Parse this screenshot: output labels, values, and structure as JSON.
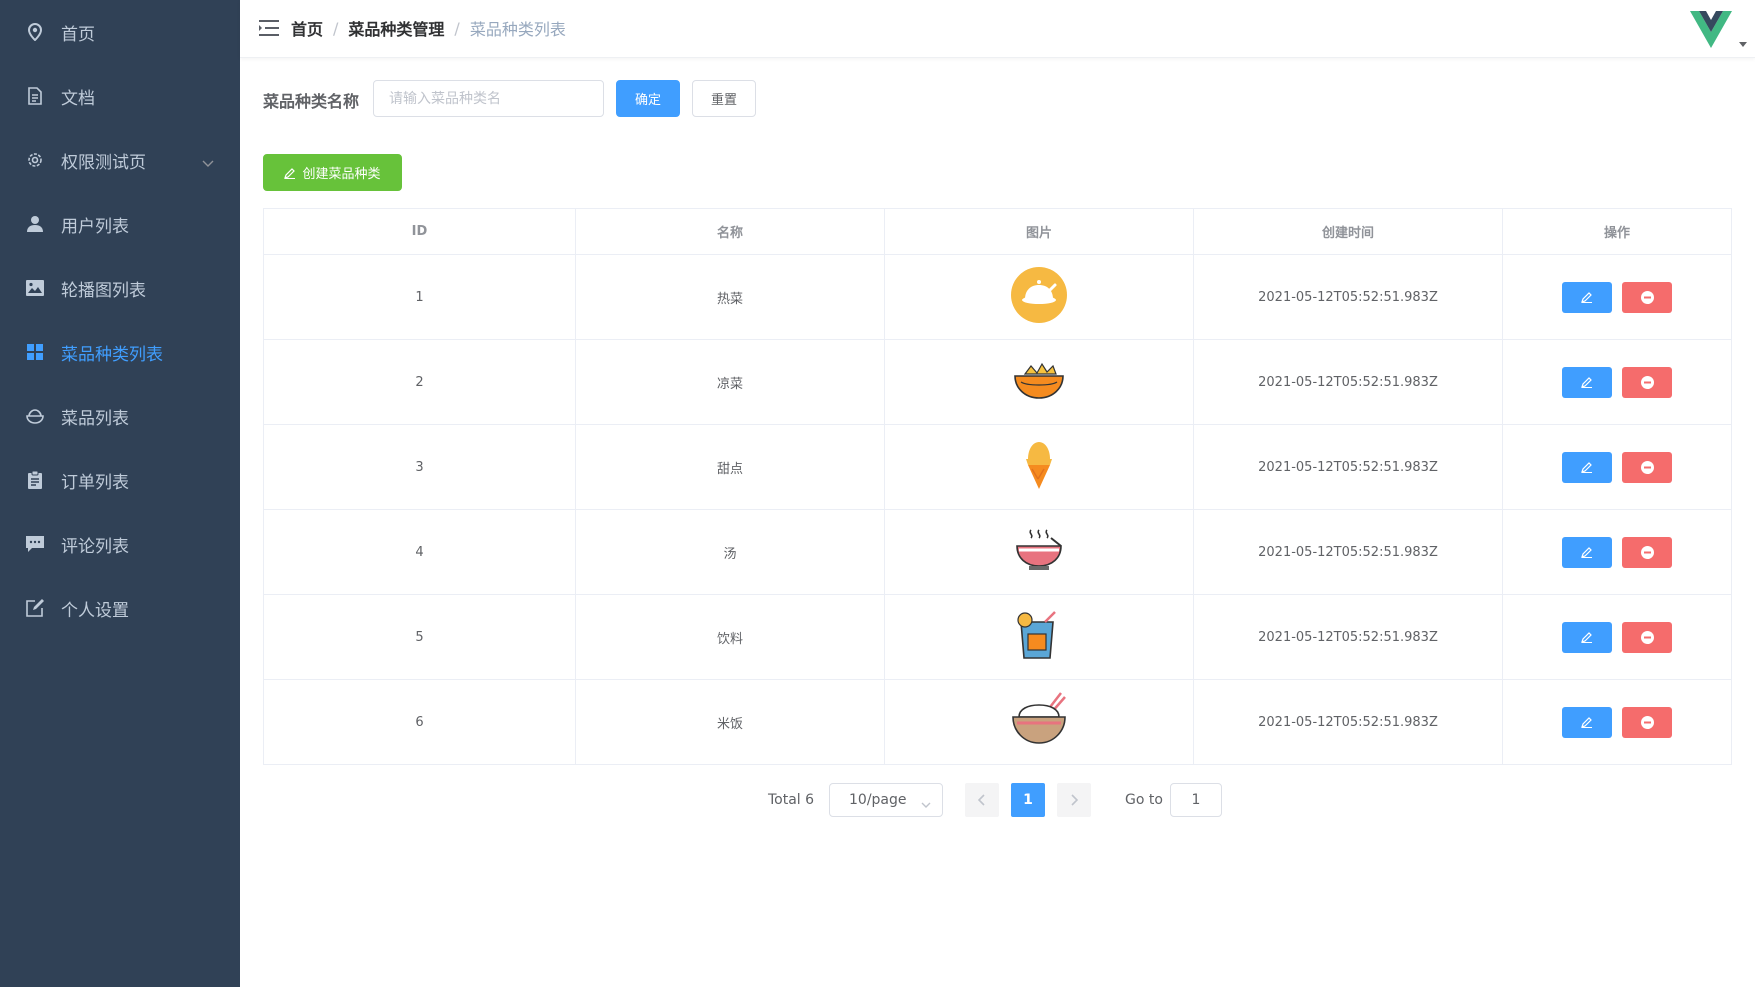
{
  "sidebar": {
    "items": [
      {
        "label": "首页",
        "icon": "location-pin-icon",
        "active": false
      },
      {
        "label": "文档",
        "icon": "document-icon",
        "active": false
      },
      {
        "label": "权限测试页",
        "icon": "gear-icon",
        "active": false,
        "has_submenu": true
      },
      {
        "label": "用户列表",
        "icon": "user-icon",
        "active": false
      },
      {
        "label": "轮播图列表",
        "icon": "picture-icon",
        "active": false
      },
      {
        "label": "菜品种类列表",
        "icon": "grid-icon",
        "active": true
      },
      {
        "label": "菜品列表",
        "icon": "bowl-icon",
        "active": false
      },
      {
        "label": "订单列表",
        "icon": "clipboard-icon",
        "active": false
      },
      {
        "label": "评论列表",
        "icon": "chat-icon",
        "active": false
      },
      {
        "label": "个人设置",
        "icon": "edit-icon",
        "active": false
      }
    ]
  },
  "header": {
    "breadcrumb": [
      "首页",
      "菜品种类管理",
      "菜品种类列表"
    ],
    "avatar_icon": "vue-logo-icon"
  },
  "filter": {
    "label": "菜品种类名称",
    "input_value": "",
    "input_placeholder": "请输入菜品种类名",
    "confirm_label": "确定",
    "reset_label": "重置"
  },
  "create_button_label": "创建菜品种类",
  "table": {
    "columns": [
      "ID",
      "名称",
      "图片",
      "创建时间",
      "操作"
    ],
    "rows": [
      {
        "id": "1",
        "name": "热菜",
        "image": "roast-chicken-icon",
        "created": "2021-05-12T05:52:51.983Z"
      },
      {
        "id": "2",
        "name": "凉菜",
        "image": "cold-dish-bowl-icon",
        "created": "2021-05-12T05:52:51.983Z"
      },
      {
        "id": "3",
        "name": "甜点",
        "image": "ice-cream-icon",
        "created": "2021-05-12T05:52:51.983Z"
      },
      {
        "id": "4",
        "name": "汤",
        "image": "soup-bowl-icon",
        "created": "2021-05-12T05:52:51.983Z"
      },
      {
        "id": "5",
        "name": "饮料",
        "image": "drink-cup-icon",
        "created": "2021-05-12T05:52:51.983Z"
      },
      {
        "id": "6",
        "name": "米饭",
        "image": "rice-bowl-icon",
        "created": "2021-05-12T05:52:51.983Z"
      }
    ]
  },
  "pagination": {
    "total_text": "Total 6",
    "page_size": "10/page",
    "current_page": "1",
    "goto_label": "Go to",
    "goto_value": "1"
  },
  "colors": {
    "sidebar_bg": "#304156",
    "sidebar_text": "#bfcbd9",
    "accent": "#409eff",
    "success": "#67c23a",
    "danger": "#f56c6c"
  }
}
